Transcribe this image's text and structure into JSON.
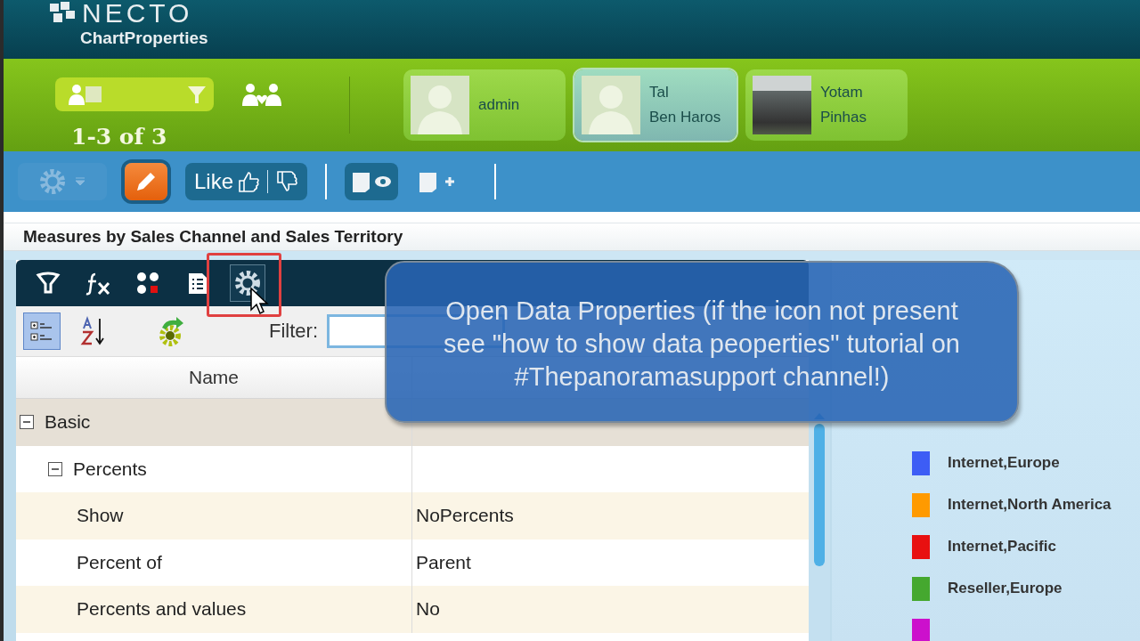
{
  "header": {
    "logo": "NECTO",
    "subtitle": "ChartProperties"
  },
  "user_bar": {
    "count": "1-3 of 3",
    "users": [
      {
        "first": "admin",
        "photo": false,
        "selected": false
      },
      {
        "first": "Tal",
        "last": "Ben Haros",
        "photo": false,
        "selected": true
      },
      {
        "first": "Yotam",
        "last": "Pinhas",
        "photo": true,
        "selected": false
      }
    ]
  },
  "toolbar": {
    "settings_disabled": true,
    "edit_active": true,
    "like_label": "Like"
  },
  "panel": {
    "title": "Measures by Sales Channel and Sales Territory",
    "tools": [
      {
        "kind": "filter",
        "selected": false
      },
      {
        "kind": "formula",
        "selected": false
      },
      {
        "kind": "dots",
        "selected": false
      },
      {
        "kind": "list",
        "selected": false
      },
      {
        "kind": "gear",
        "selected": true
      }
    ],
    "categorized": true,
    "filter_label": "Filter:",
    "columns": [
      "Name"
    ],
    "rows": [
      {
        "name": "Basic",
        "expanded": true,
        "children": [
          {
            "name": "Percents",
            "expanded": true,
            "children": [
              {
                "name": "Show",
                "value": "NoPercents"
              },
              {
                "name": "Percent of",
                "value": "Parent"
              },
              {
                "name": "Percents and values",
                "value": "No"
              }
            ]
          }
        ]
      }
    ]
  },
  "legend": [
    {
      "label": "Internet,Europe",
      "color": "#3d5df5"
    },
    {
      "label": "Internet,North America",
      "color": "#ff9a00"
    },
    {
      "label": "Internet,Pacific",
      "color": "#e81010"
    },
    {
      "label": "Reseller,Europe",
      "color": "#45a82f"
    },
    {
      "color": "#cc10cc"
    }
  ],
  "callout": "Open Data Properties (if the icon not present see \"how to show data peoperties\" tutorial on #Thepanoramasupport channel!)"
}
